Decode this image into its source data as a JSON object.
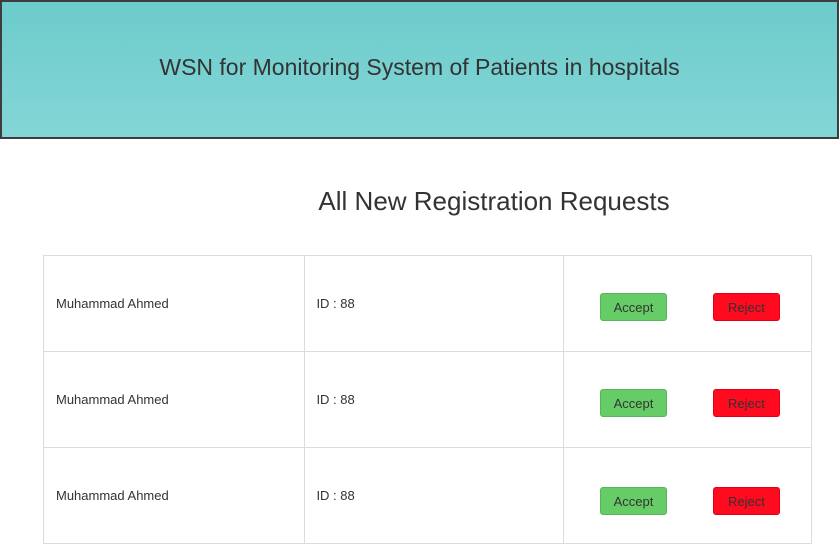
{
  "header": {
    "title": "WSN for Monitoring System of Patients in hospitals"
  },
  "main": {
    "title": "All New Registration Requests",
    "requests": [
      {
        "name": "Muhammad Ahmed",
        "id_text": "ID : 88",
        "accept_label": "Accept",
        "reject_label": "Reject"
      },
      {
        "name": "Muhammad Ahmed",
        "id_text": "ID : 88",
        "accept_label": "Accept",
        "reject_label": "Reject"
      },
      {
        "name": "Muhammad Ahmed",
        "id_text": "ID : 88",
        "accept_label": "Accept",
        "reject_label": "Reject"
      }
    ]
  },
  "colors": {
    "header_bg": "#78d0d0",
    "accept": "#66cc66",
    "reject": "#ff0a1e",
    "text": "#333333"
  }
}
